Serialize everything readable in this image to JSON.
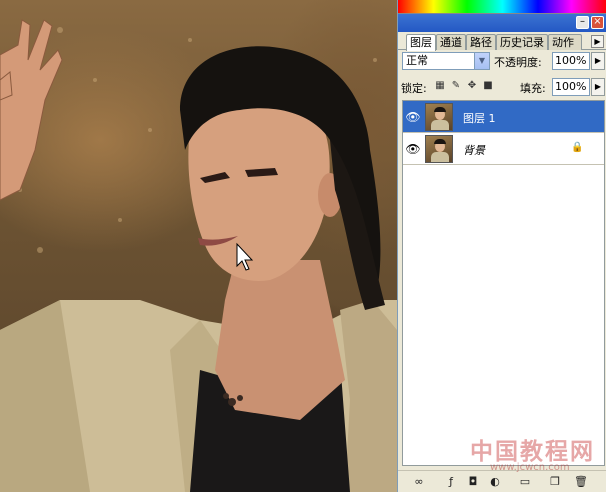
{
  "panel": {
    "tabs": [
      {
        "label": "图层",
        "active": true
      },
      {
        "label": "通道"
      },
      {
        "label": "路径"
      },
      {
        "label": "历史记录"
      },
      {
        "label": "动作"
      }
    ],
    "blend_mode": "正常",
    "opacity_label": "不透明度:",
    "opacity_value": "100%",
    "lock_label": "锁定:",
    "fill_label": "填充:",
    "fill_value": "100%",
    "layers": [
      {
        "name": "图层 1",
        "selected": true,
        "locked": false
      },
      {
        "name": "背景",
        "selected": false,
        "locked": true
      }
    ]
  },
  "watermark": {
    "text": "中国教程网",
    "url": "www.jcwcn.com"
  },
  "colors": {
    "selection": "#316ac5",
    "panel_bg": "#ece9d8",
    "titlebar": "#2458c4"
  }
}
